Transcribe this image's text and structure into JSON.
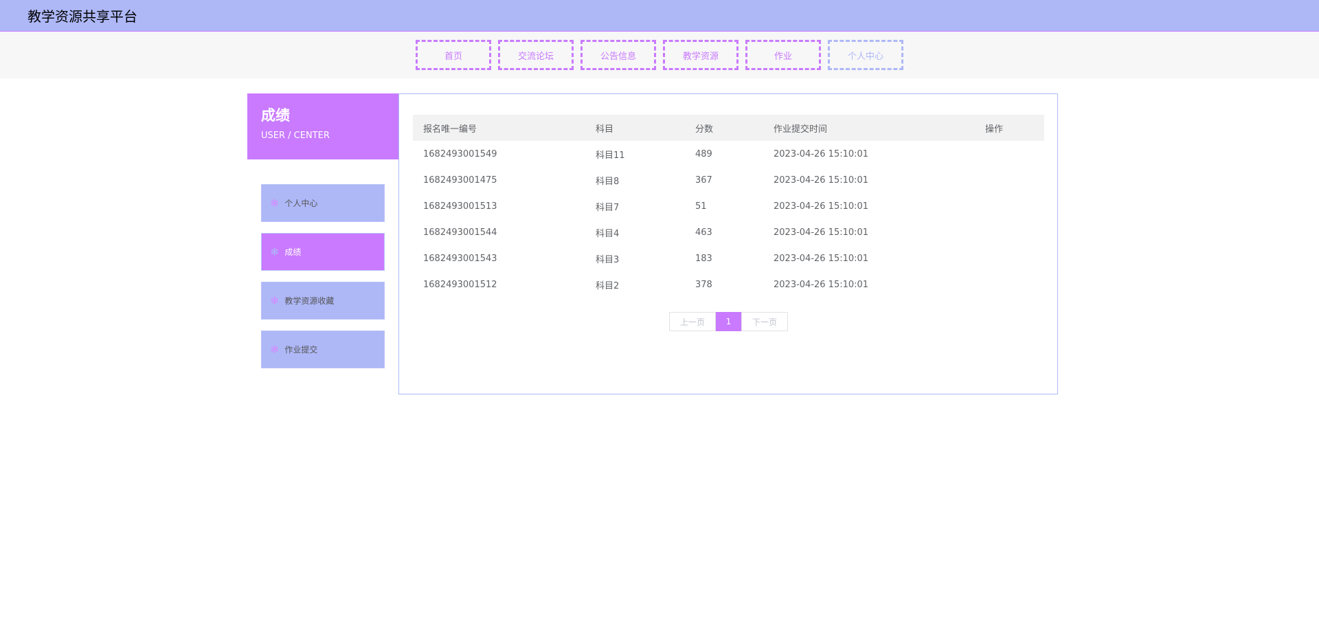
{
  "header": {
    "site_title": "教学资源共享平台"
  },
  "nav": [
    {
      "label": "首页",
      "active": false
    },
    {
      "label": "交流论坛",
      "active": false
    },
    {
      "label": "公告信息",
      "active": false
    },
    {
      "label": "教学资源",
      "active": false
    },
    {
      "label": "作业",
      "active": false
    },
    {
      "label": "个人中心",
      "active": true
    }
  ],
  "sidebar": {
    "title": "成绩",
    "subtitle": "USER / CENTER",
    "items": [
      {
        "label": "个人中心",
        "icon": "snowflake-icon",
        "active": false
      },
      {
        "label": "成绩",
        "icon": "snowflake-icon",
        "active": true
      },
      {
        "label": "教学资源收藏",
        "icon": "snowflake-icon",
        "active": false
      },
      {
        "label": "作业提交",
        "icon": "snowflake-icon",
        "active": false
      }
    ]
  },
  "table": {
    "headers": [
      "报名唯一编号",
      "科目",
      "分数",
      "作业提交时间",
      "操作"
    ],
    "rows": [
      [
        "1682493001549",
        "科目11",
        "489",
        "2023-04-26 15:10:01",
        ""
      ],
      [
        "1682493001475",
        "科目8",
        "367",
        "2023-04-26 15:10:01",
        ""
      ],
      [
        "1682493001513",
        "科目7",
        "51",
        "2023-04-26 15:10:01",
        ""
      ],
      [
        "1682493001544",
        "科目4",
        "463",
        "2023-04-26 15:10:01",
        ""
      ],
      [
        "1682493001543",
        "科目3",
        "183",
        "2023-04-26 15:10:01",
        ""
      ],
      [
        "1682493001512",
        "科目2",
        "378",
        "2023-04-26 15:10:01",
        ""
      ]
    ]
  },
  "pagination": {
    "prev": "上一页",
    "current": "1",
    "next": "下一页"
  },
  "colors": {
    "accent_purple": "#c97aff",
    "accent_blue": "#aeb8f7",
    "header_bg": "#aeb8f7",
    "table_header_bg": "#f2f2f2"
  }
}
